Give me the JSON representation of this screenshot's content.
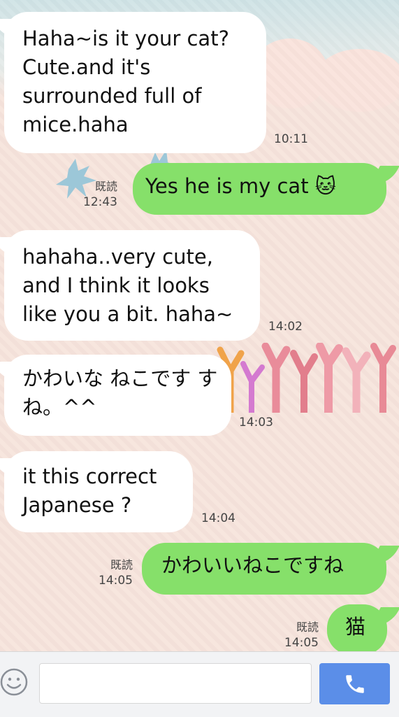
{
  "messages": [
    {
      "side": "received",
      "text_lines": [
        "Haha~is it your cat?",
        "Cute.and it's",
        "surrounded full of",
        "mice.haha"
      ],
      "time": "10:11"
    },
    {
      "side": "sent",
      "text": "Yes he is my cat 🐱",
      "read": "既読",
      "time": "12:43"
    },
    {
      "side": "received",
      "text_lines": [
        "hahaha..very cute,",
        "and I think it looks",
        "like you a bit. haha~"
      ],
      "time": "14:02"
    },
    {
      "side": "received",
      "text_lines": [
        "かわいな ねこです す",
        "ね。^^"
      ],
      "time": "14:03"
    },
    {
      "side": "received",
      "text_lines": [
        "it this correct",
        "Japanese ?"
      ],
      "time": "14:04"
    },
    {
      "side": "sent",
      "text": "かわいいねこですね",
      "read": "既読",
      "time": "14:05"
    },
    {
      "side": "sent",
      "text": "猫",
      "read": "既読",
      "time": "14:05"
    }
  ],
  "input": {
    "placeholder": "",
    "value": ""
  },
  "icons": {
    "emoji": "smiley-icon",
    "call": "phone-icon"
  },
  "colors": {
    "sent_bubble": "#86e06a",
    "received_bubble": "#ffffff",
    "call_button": "#5b8ee8"
  }
}
